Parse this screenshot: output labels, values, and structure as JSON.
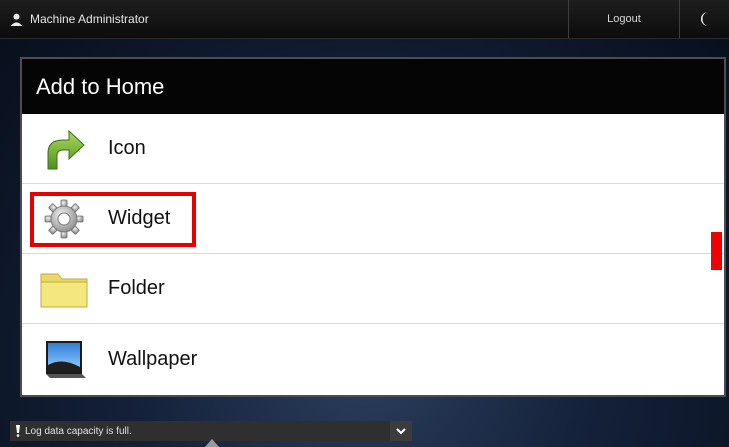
{
  "topbar": {
    "user_name": "Machine Administrator",
    "logout_label": "Logout"
  },
  "dialog": {
    "title": "Add to Home",
    "items": [
      {
        "label": "Icon",
        "icon": "arrow-shortcut-icon"
      },
      {
        "label": "Widget",
        "icon": "gear-icon",
        "highlighted": true
      },
      {
        "label": "Folder",
        "icon": "folder-icon"
      },
      {
        "label": "Wallpaper",
        "icon": "wallpaper-icon"
      }
    ]
  },
  "status": {
    "message": "Log data capacity is full."
  },
  "colors": {
    "highlight": "#e60000",
    "titlebar": "#050505"
  }
}
